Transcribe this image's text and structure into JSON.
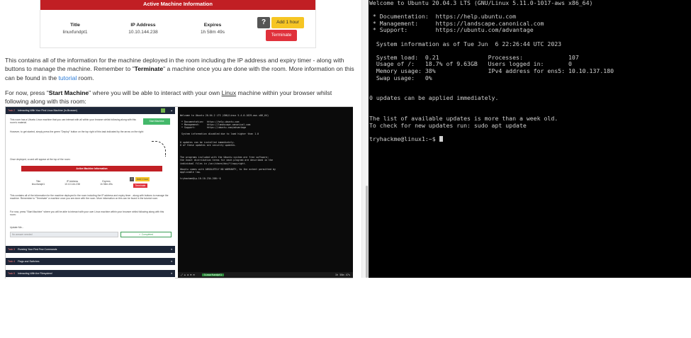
{
  "machine_card": {
    "header": "Active Machine Information",
    "title_label": "Title",
    "title_value": "linuxfundpt1",
    "ip_label": "IP Address",
    "ip_value": "10.10.144.238",
    "expires_label": "Expires",
    "expires_value": "1h 58m 49s",
    "help_label": "?",
    "add_hour_label": "Add 1 hour",
    "terminate_label": "Terminate"
  },
  "content": {
    "para1_a": "This contains all of the information for the machine deployed in the room including the IP address and expiry timer - along with buttons to manage the machine. Remember to \"",
    "para1_b": "Terminate",
    "para1_c": "\" a machine once you are done with the room. More information on this can be found in the ",
    "para1_link": "tutorial",
    "para1_d": " room.",
    "para2_a": "For now, press \"",
    "para2_b": "Start Machine",
    "para2_c": "\" where you will be able to interact with your own ",
    "para2_u": "Linux",
    "para2_d": " machine within your browser whilst following along with this room:"
  },
  "mini_room": {
    "task1": "Interacting With Your First Linux Machine (In-Browser)",
    "task1_num": "Task 2",
    "intro": "This room has a Ubuntu Linux machine that you can interact with all within your browser whilst following along with this room's material.",
    "intro2": "However, to get started, simply press the green \"Deploy\" button on the top right of this task indicated by the arrow on the right:",
    "start_btn": "Start Machine",
    "deployed": "Once deployed, a card will appear at the top of the room:",
    "card_header": "Active Machine Information",
    "title_label": "Title",
    "title_value": "linuxfundpt1",
    "ip_label": "IP Address",
    "ip_value": "10.10.144.238",
    "exp_label": "Expires",
    "exp_value": "1h 58m 49s",
    "add_label": "Add 1 hour",
    "term_label": "Terminate",
    "para_a": "This contains all of the information for the machine deployed in the room including the IP address and expiry timer - along with buttons to manage the machine. Remember to \"Terminate\" a machine once you are done with the room. More information on this can be found in the tutorial room.",
    "para_b": "For now, press \"Start Machine\" where you will be able to interact with your own Linux machine within your browser whilst following along with this room:",
    "update_label": "Update Me...",
    "no_answer": "No answer needed",
    "completed": "✓ Completed",
    "task2_num": "Task 3",
    "task2": "Running Your First Few Commands",
    "task3_num": "Task 4",
    "task3": "Flags and Switches",
    "task4_num": "Task 5",
    "task4": "Interacting With the Filesystem!"
  },
  "mini_terminal": {
    "text": "Welcome to Ubuntu 20.04.2 LTS (GNU/Linux 5.4.0-1029-aws x86_64)\n\n * Documentation:  https://help.ubuntu.com\n * Management:     https://landscape.canonical.com\n * Support:        https://ubuntu.com/advantage\n\n System information disabled due to load higher than 1.0\n\n\n0 updates can be installed immediately.\n0 of these updates are security updates.\n\n\n\nThe programs included with the Ubuntu system are free software;\nthe exact distribution terms for each program are described in the\nindividual files in /usr/share/doc/*/copyright.\n\nUbuntu comes with ABSOLUTELY NO WARRANTY, to the extent permitted by\napplicable law.\n\ntryhackme@ip-10-10-234-208:~$ ",
    "tag": "linuxfundpt1",
    "time": "1h 58m 47s"
  },
  "terminal": {
    "lines": [
      "Welcome to Ubuntu 20.04.3 LTS (GNU/Linux 5.11.0-1017-aws x86_64)",
      "",
      " * Documentation:  https://help.ubuntu.com",
      " * Management:     https://landscape.canonical.com",
      " * Support:        https://ubuntu.com/advantage",
      "",
      "  System information as of Tue Jun  6 22:26:44 UTC 2023",
      "",
      "  System load:  0.21              Processes:             107",
      "  Usage of /:   18.7% of 9.63GB   Users logged in:       0",
      "  Memory usage: 38%               IPv4 address for ens5: 10.10.137.180",
      "  Swap usage:   0%",
      "",
      "",
      "0 updates can be applied immediately.",
      "",
      "",
      "The list of available updates is more than a week old.",
      "To check for new updates run: sudo apt update",
      "",
      "tryhackme@linux1:~$ "
    ]
  }
}
